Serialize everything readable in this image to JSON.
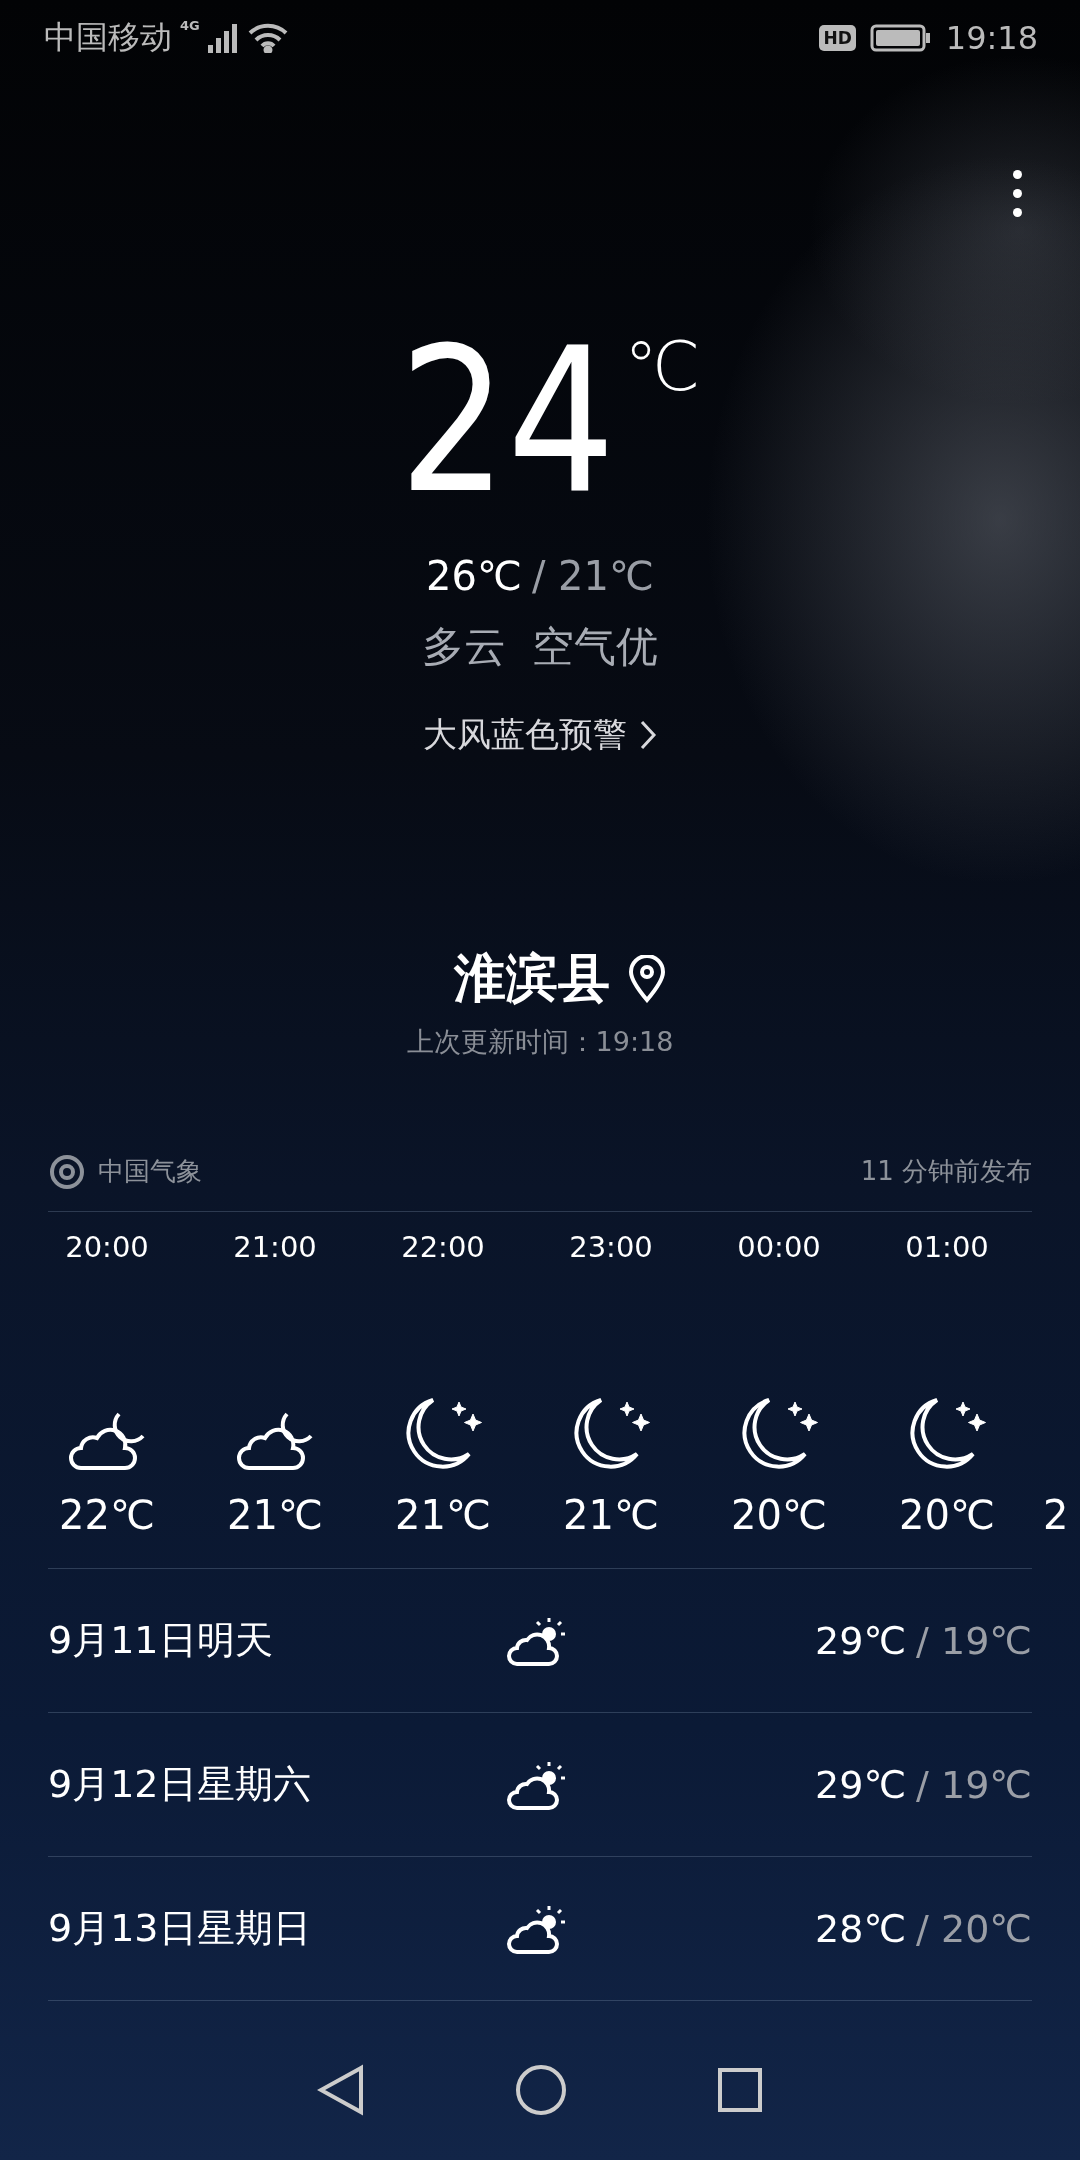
{
  "status_bar": {
    "carrier": "中国移动",
    "network": "4G",
    "time": "19:18",
    "hd": "HD"
  },
  "current": {
    "temp": "24",
    "unit": "℃",
    "high": "26℃",
    "low": "/ 21℃",
    "condition": "多云",
    "air": "空气优",
    "alert": "大风蓝色预警"
  },
  "location": {
    "name": "淮滨县",
    "updated": "上次更新时间：19:18"
  },
  "source": {
    "name": "中国气象",
    "published": "11 分钟前发布"
  },
  "hourly": [
    {
      "time": "20:00",
      "kind": "cloudy-night",
      "temp": "22℃"
    },
    {
      "time": "21:00",
      "kind": "cloudy-night",
      "temp": "21℃"
    },
    {
      "time": "22:00",
      "kind": "clear-night",
      "temp": "21℃"
    },
    {
      "time": "23:00",
      "kind": "clear-night",
      "temp": "21℃"
    },
    {
      "time": "00:00",
      "kind": "clear-night",
      "temp": "20℃"
    },
    {
      "time": "01:00",
      "kind": "clear-night",
      "temp": "20℃"
    },
    {
      "kind": "cut",
      "temp": "2"
    }
  ],
  "daily": [
    {
      "date": "9月11日明天",
      "kind": "partly-cloudy",
      "high": "29℃",
      "low": "/ 19℃"
    },
    {
      "date": "9月12日星期六",
      "kind": "partly-cloudy",
      "high": "29℃",
      "low": "/ 19℃"
    },
    {
      "date": "9月13日星期日",
      "kind": "partly-cloudy",
      "high": "28℃",
      "low": "/ 20℃"
    }
  ]
}
